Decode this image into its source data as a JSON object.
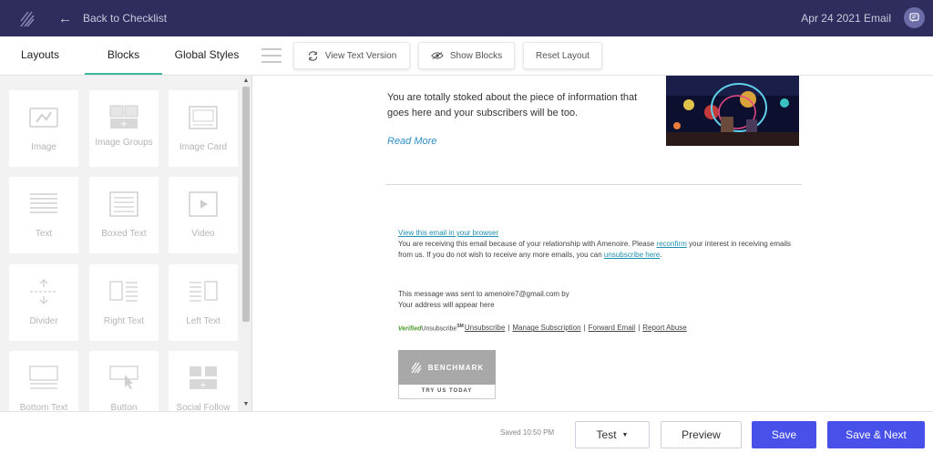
{
  "header": {
    "logo_icon": "benchmark-logo-icon",
    "back_label": "Back to Checklist",
    "email_title": "Apr 24 2021 Email",
    "chat_icon": "chat-icon",
    "bg_color": "#2e2d5e"
  },
  "tabs": [
    {
      "label": "Layouts",
      "active": false
    },
    {
      "label": "Blocks",
      "active": true
    },
    {
      "label": "Global Styles",
      "active": false
    }
  ],
  "toolbar": {
    "view_text_label": "View Text Version",
    "show_blocks_label": "Show Blocks",
    "reset_layout_label": "Reset Layout"
  },
  "blocks": [
    {
      "label": "Image",
      "icon": "image-icon"
    },
    {
      "label": "Image Groups",
      "icon": "image-groups-icon"
    },
    {
      "label": "Image Card",
      "icon": "image-card-icon"
    },
    {
      "label": "Text",
      "icon": "text-icon"
    },
    {
      "label": "Boxed Text",
      "icon": "boxed-text-icon"
    },
    {
      "label": "Video",
      "icon": "video-icon"
    },
    {
      "label": "Divider",
      "icon": "divider-icon"
    },
    {
      "label": "Right Text",
      "icon": "right-text-icon"
    },
    {
      "label": "Left Text",
      "icon": "left-text-icon"
    },
    {
      "label": "Bottom Text",
      "icon": "bottom-text-icon"
    },
    {
      "label": "Button",
      "icon": "button-icon"
    },
    {
      "label": "Social Follow",
      "icon": "social-follow-icon"
    }
  ],
  "email": {
    "body_text": "You are totally stoked about the piece of information that goes here and your subscribers will be too.",
    "read_more": "Read More",
    "view_in_browser": "View this email in your browser",
    "receiving_pre": "You are receiving this email because of your relationship with Amenoire. Please ",
    "reconfirm": "reconfirm",
    "receiving_mid": " your interest in receiving emails from us. If you do not wish to receive any more emails, you can ",
    "unsubscribe_here": "unsubscribe here",
    "receiving_post": ".",
    "sent_to": "This message was sent to amenoire7@gmail.com by",
    "address": "Your address will appear here",
    "verified_a": "Verified",
    "verified_b": "Unsubscribe",
    "verified_sup": "SM",
    "unsubscribe": "Unsubscribe",
    "manage_subscription": "Manage Subscription",
    "forward_email": "Forward Email",
    "report_abuse": "Report Abuse",
    "separator": "|",
    "badge_text": "BENCHMARK",
    "badge_sub": "TRY US TODAY"
  },
  "footer": {
    "saved_status": "Saved 10:50 PM",
    "test_label": "Test",
    "preview_label": "Preview",
    "save_label": "Save",
    "save_next_label": "Save & Next",
    "primary_color": "#4750e8"
  }
}
